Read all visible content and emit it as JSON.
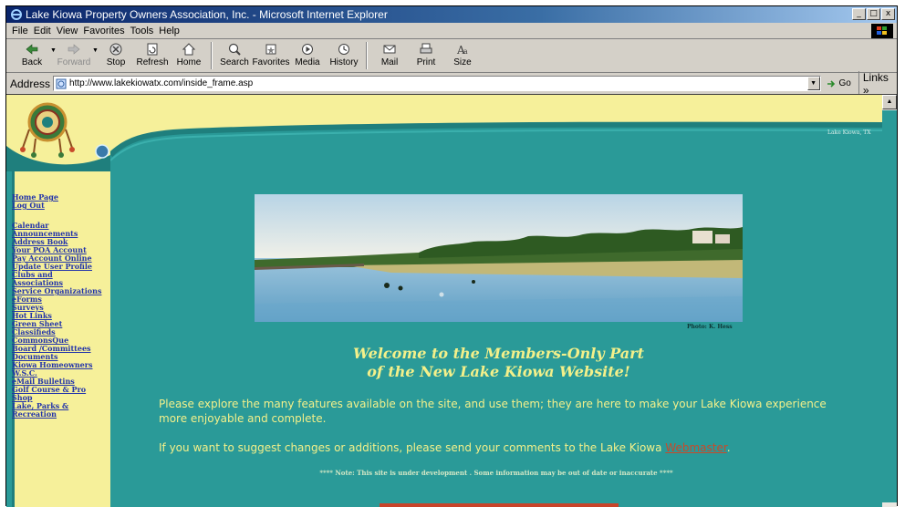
{
  "window": {
    "title": "Lake Kiowa Property Owners Association, Inc. - Microsoft Internet Explorer",
    "controls": {
      "minimize": "_",
      "maximize": "□",
      "close": "x"
    }
  },
  "menubar": {
    "items": [
      "File",
      "Edit",
      "View",
      "Favorites",
      "Tools",
      "Help"
    ]
  },
  "toolbar": {
    "back": "Back",
    "forward": "Forward",
    "stop": "Stop",
    "refresh": "Refresh",
    "home": "Home",
    "search": "Search",
    "favorites": "Favorites",
    "media": "Media",
    "history": "History",
    "mail": "Mail",
    "print": "Print",
    "size": "Size"
  },
  "addressbar": {
    "label": "Address",
    "url": "http://www.lakekiowatx.com/inside_frame.asp",
    "go": "Go",
    "links": "Links »"
  },
  "sidebar": {
    "nav_items": [
      "Home Page",
      "Log Out",
      "Calendar",
      "Announcements",
      "Address Book",
      "Your POA Account",
      "Pay Account Online",
      "Update User Profile",
      "Clubs and Associations",
      "Service Organizations",
      "eForms",
      "Surveys",
      "Hot Links",
      "Green Sheet Classifieds",
      "CommonsQue",
      "Board /Committees",
      "Documents",
      "Kiowa Homeowners W.S.C.",
      "eMail Bulletins",
      "Golf Course & Pro Shop",
      "Lake, Parks & Recreation"
    ]
  },
  "content": {
    "corner_text": "Lake Kiowa, TX",
    "photo_credit": "Photo: K. Hess",
    "welcome_line1": "Welcome to the Members-Only Part",
    "welcome_line2": "of the New Lake Kiowa Website!",
    "intro": "Please explore the many features available on the site, and use them; they are here to make your Lake Kiowa experience more enjoyable and complete.",
    "suggest_prefix": "If you want to suggest changes or additions, please send your comments to the Lake Kiowa ",
    "suggest_link": "Webmaster",
    "suggest_suffix": ".",
    "note": "**** Note: This site is under development . Some information may be out of date or inaccurate ****"
  },
  "colors": {
    "page_bg": "#2a9a98",
    "sidebar_bg": "#f6f09a",
    "welcome_text": "#f3f08a",
    "link": "#2233aa",
    "webmaster_link": "#c84a2a"
  }
}
